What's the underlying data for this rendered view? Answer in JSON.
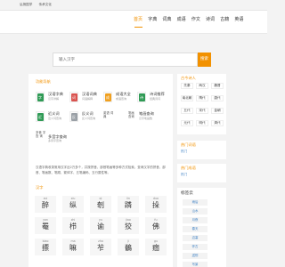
{
  "topbar": {
    "site_name": "弘扬国学",
    "slogan": "传承文化"
  },
  "nav": {
    "items": [
      "首页",
      "字典",
      "词典",
      "成语",
      "作文",
      "诗词",
      "古籍",
      "英语"
    ],
    "active_index": 0
  },
  "search": {
    "placeholder": "输入汉字",
    "button_label": "搜索"
  },
  "tools": {
    "title": "功能导航",
    "items": [
      {
        "name": "汉语字典",
        "desc": "汉字详解",
        "color": "#2f9a55",
        "glyph": "字"
      },
      {
        "name": "汉语词典",
        "desc": "词语解释",
        "color": "#d9534f",
        "glyph": "词"
      },
      {
        "name": "成语大全",
        "desc": "成语查询",
        "color": "#f0a020",
        "glyph": "成"
      },
      {
        "name": "诗词推荐",
        "desc": "经典诗词",
        "color": "#2f9a55",
        "glyph": "诗"
      },
      {
        "name": "近义词",
        "desc": "近义词查询",
        "color": "#2f9a55",
        "glyph": "近"
      },
      {
        "name": "反义词",
        "desc": "反义词查询",
        "color": "#9aa0a6",
        "glyph": "反"
      },
      {
        "name": "英语词典",
        "broken": "英语 词典"
      },
      {
        "name": "笔画查询",
        "desc": "汉字笔画数",
        "broken": "笔画 查询"
      },
      {
        "name": "多音字查询",
        "desc": "多音字查询",
        "broken": "多音 字查 询"
      }
    ]
  },
  "intro": "汉语字典收录常用汉字近2万多个，并按拼音、部首笔画等多种方式检索，查询汉字的拼音、部首、笔画数、笔顺、繁体字、五笔编码、五行属性等。",
  "zi_section": {
    "title": "汉字",
    "items": [
      {
        "py": "zui",
        "hz": "醉"
      },
      {
        "py": "xiu",
        "hz": "纵"
      },
      {
        "py": "qi",
        "hz": "剞"
      },
      {
        "py": "lin",
        "hz": "蹸"
      },
      {
        "py": "duo",
        "hz": "挆"
      },
      {
        "py": "yan",
        "hz": "罨"
      },
      {
        "py": "zhi",
        "hz": "栉"
      },
      {
        "py": "yu",
        "hz": "谕"
      },
      {
        "py": "jiao",
        "hz": "狡"
      },
      {
        "py": "fu",
        "hz": "佛"
      },
      {
        "py": "biao",
        "hz": "摽"
      },
      {
        "py": "ma",
        "hz": "嘛"
      },
      {
        "py": "zha",
        "hz": "苲"
      },
      {
        "py": "ji",
        "hz": "鶺"
      },
      {
        "py": "gu",
        "hz": "痼"
      }
    ]
  },
  "poets": {
    "title": "古今诗人",
    "items": [
      "先秦",
      "两汉",
      "魏晋",
      "南北朝",
      "隋代",
      "唐代",
      "五代",
      "宋代",
      "金朝",
      "元代",
      "明代",
      "清代"
    ]
  },
  "hot_words": {
    "title": "热门词语",
    "link": "热门"
  },
  "hot_idioms": {
    "title": "热门成语",
    "link": "热门"
  },
  "tags": {
    "title": "标签云",
    "items": [
      "雨后",
      "山水",
      "月夜",
      "春天",
      "边塞",
      "怀古",
      "送别",
      "写景",
      "秋天",
      "咏物",
      "思乡",
      "清明"
    ]
  }
}
